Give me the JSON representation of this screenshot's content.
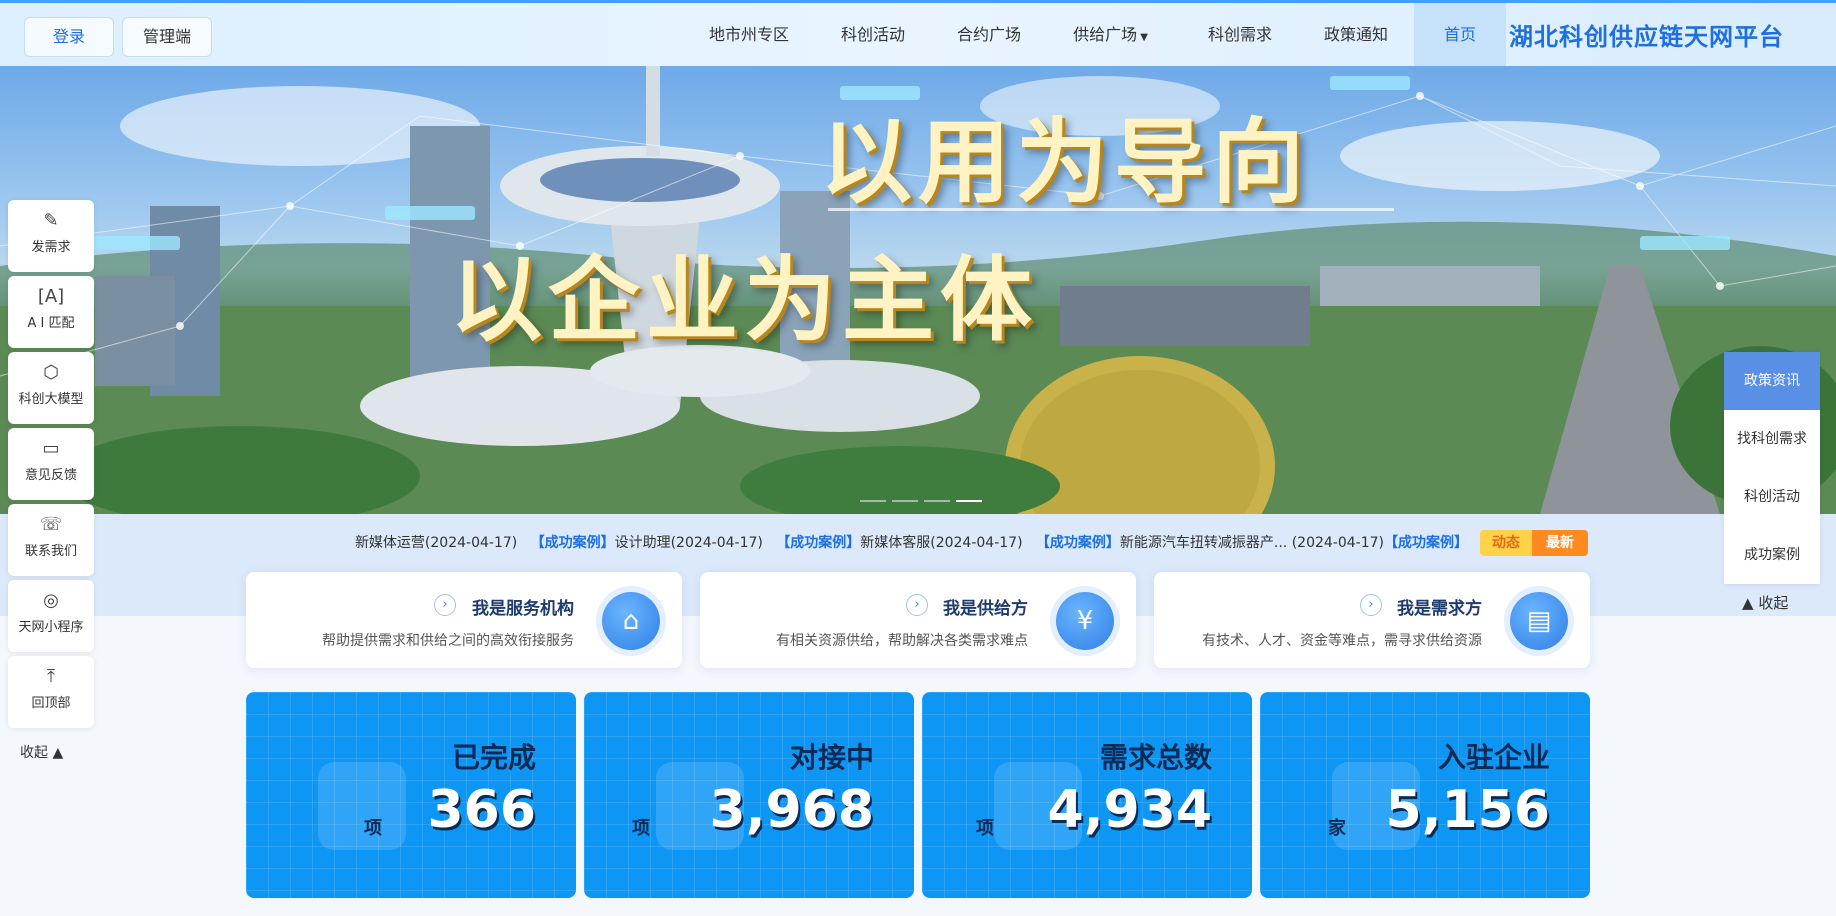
{
  "header": {
    "logo": "湖北科创供应链天网平台",
    "nav": [
      {
        "label": "首页",
        "active": true
      },
      {
        "label": "政策通知"
      },
      {
        "label": "科创需求"
      },
      {
        "label": "供给广场"
      },
      {
        "label": "合约广场"
      },
      {
        "label": "科创活动"
      },
      {
        "label": "地市州专区"
      }
    ],
    "admin_label": "管理端",
    "login_label": "登录"
  },
  "banner": {
    "slogan_1": "以用为导向",
    "slogan_2": "以企业为主体"
  },
  "ticker": {
    "badge_1": "最新",
    "badge_2": "动态",
    "items": [
      {
        "tag": "【成功案例】",
        "text": "新能源汽车扭转减振器产... (2024-04-17)"
      },
      {
        "tag": "【成功案例】",
        "text": "新媒体客服(2024-04-17)"
      },
      {
        "tag": "【成功案例】",
        "text": "设计助理(2024-04-17)"
      },
      {
        "tag": "【成功案例】",
        "text": "新媒体运营(2024-04-17)"
      }
    ]
  },
  "roles": [
    {
      "title": "我是需求方",
      "desc": "有技术、人才、资金等难点，需寻求供给资源",
      "icon": "document-icon"
    },
    {
      "title": "我是供给方",
      "desc": "有相关资源供给，帮助解决各类需求难点",
      "icon": "money-hand-icon"
    },
    {
      "title": "我是服务机构",
      "desc": "帮助提供需求和供给之间的高效衔接服务",
      "icon": "bank-icon"
    }
  ],
  "stats": [
    {
      "label": "入驻企业",
      "value": "5,156",
      "unit": "家"
    },
    {
      "label": "需求总数",
      "value": "4,934",
      "unit": "项"
    },
    {
      "label": "对接中",
      "value": "3,968",
      "unit": "项"
    },
    {
      "label": "已完成",
      "value": "366",
      "unit": "项"
    }
  ],
  "left_tools": [
    {
      "label": "发需求",
      "icon": "pen-icon"
    },
    {
      "label": "A I 匹配",
      "icon": "ai-icon"
    },
    {
      "label": "科创大模型",
      "icon": "cube-icon"
    },
    {
      "label": "意见反馈",
      "icon": "chat-icon"
    },
    {
      "label": "联系我们",
      "icon": "headset-icon"
    },
    {
      "label": "天网小程序",
      "icon": "miniprogram-icon"
    },
    {
      "label": "回顶部",
      "icon": "arrow-up-icon"
    }
  ],
  "left_collapse": "收起",
  "right_tabs": [
    {
      "label": "政策资讯",
      "active": true
    },
    {
      "label": "找科创需求"
    },
    {
      "label": "科创活动"
    },
    {
      "label": "成功案例"
    }
  ],
  "right_collapse": "收起",
  "colors": {
    "primary": "#1e6fe0",
    "stat_bg": "#0e96f5",
    "accent_orange": "#ff8a1e"
  }
}
